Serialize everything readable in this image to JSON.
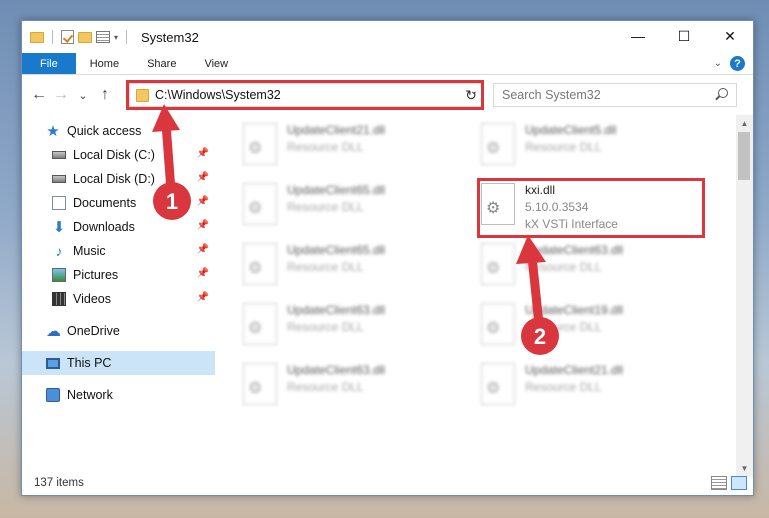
{
  "window": {
    "title": "System32",
    "controls": {
      "minimize": "—",
      "maximize": "☐",
      "close": "✕"
    }
  },
  "ribbon": {
    "tabs": [
      {
        "label": "File"
      },
      {
        "label": "Home"
      },
      {
        "label": "Share"
      },
      {
        "label": "View"
      }
    ],
    "expand_icon": "chevron-down-icon",
    "help": "?"
  },
  "navigation": {
    "back": "←",
    "forward": "→",
    "recent": "⌄",
    "up": "↑",
    "address": "C:\\Windows\\System32",
    "refresh": "↻",
    "search_placeholder": "Search System32"
  },
  "sidebar": {
    "items": [
      {
        "label": "Quick access",
        "icon": "star-icon",
        "pinned": false
      },
      {
        "label": "Local Disk (C:)",
        "icon": "disk-icon",
        "pinned": true
      },
      {
        "label": "Local Disk (D:)",
        "icon": "disk-icon",
        "pinned": true
      },
      {
        "label": "Documents",
        "icon": "documents-icon",
        "pinned": true
      },
      {
        "label": "Downloads",
        "icon": "download-icon",
        "pinned": true
      },
      {
        "label": "Music",
        "icon": "music-icon",
        "pinned": true
      },
      {
        "label": "Pictures",
        "icon": "pictures-icon",
        "pinned": true
      },
      {
        "label": "Videos",
        "icon": "videos-icon",
        "pinned": true
      },
      {
        "label": "OneDrive",
        "icon": "cloud-icon",
        "pinned": false
      },
      {
        "label": "This PC",
        "icon": "pc-icon",
        "pinned": false,
        "selected": true
      },
      {
        "label": "Network",
        "icon": "network-icon",
        "pinned": false
      }
    ]
  },
  "files": [
    {
      "name": "UpdateClient21.dll",
      "subtitle": "Resource DLL",
      "blurred": true
    },
    {
      "name": "UpdateClient5.dll",
      "subtitle": "Resource DLL",
      "blurred": true
    },
    {
      "name": "UpdateClient65.dll",
      "subtitle": "Resource DLL",
      "blurred": true
    },
    {
      "name": "kxi.dll",
      "version": "5.10.0.3534",
      "description": "kX VSTi Interface",
      "blurred": false,
      "highlighted": true
    },
    {
      "name": "UpdateClient65.dll",
      "subtitle": "Resource DLL",
      "blurred": true
    },
    {
      "name": "UpdateClient63.dll",
      "subtitle": "Resource DLL",
      "blurred": true
    },
    {
      "name": "UpdateClient63.dll",
      "subtitle": "Resource DLL",
      "blurred": true
    },
    {
      "name": "UpdateClient19.dll",
      "subtitle": "Resource DLL",
      "blurred": true
    },
    {
      "name": "UpdateClient63.dll",
      "subtitle": "Resource DLL",
      "blurred": true
    },
    {
      "name": "UpdateClient21.dll",
      "subtitle": "Resource DLL",
      "blurred": true
    }
  ],
  "status": {
    "item_count": "137 items"
  },
  "annotations": {
    "step1": "1",
    "step2": "2",
    "color": "#d9363e"
  }
}
